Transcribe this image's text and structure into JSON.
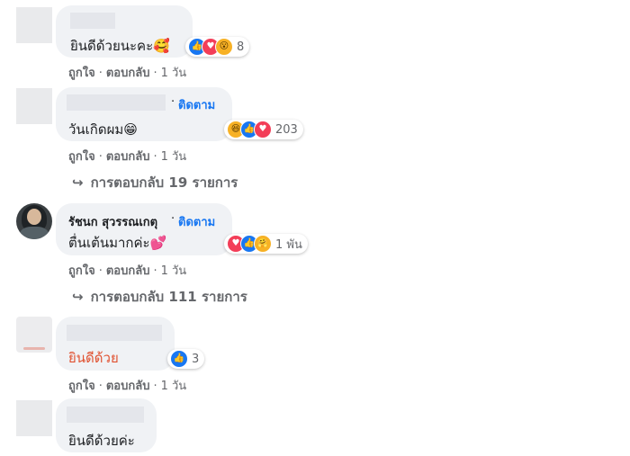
{
  "comments": [
    {
      "text": "ยินดีด้วยนะคะ🥰",
      "reaction_count": "8",
      "reaction_icons": [
        "like-icon",
        "love-icon",
        "wow-icon"
      ],
      "actions": {
        "like": "ถูกใจ",
        "reply": "ตอบกลับ",
        "time": "1 วัน"
      }
    },
    {
      "follow": "ติดตาม",
      "text": "วันเกิดผม😁",
      "reaction_count": "203",
      "reaction_icons": [
        "haha-icon",
        "like-icon",
        "love-icon"
      ],
      "actions": {
        "like": "ถูกใจ",
        "reply": "ตอบกลับ",
        "time": "1 วัน"
      },
      "replies": "การตอบกลับ 19 รายการ"
    },
    {
      "author": "รัชนก สุวรรณเกตุ",
      "follow": "ติดตาม",
      "text": "ตื่นเต้นมากค่ะ💕",
      "reaction_count": "1 พัน",
      "reaction_icons": [
        "love-icon",
        "like-icon",
        "care-icon"
      ],
      "actions": {
        "like": "ถูกใจ",
        "reply": "ตอบกลับ",
        "time": "1 วัน"
      },
      "replies": "การตอบกลับ 111 รายการ"
    },
    {
      "text": "ยินดีด้วย",
      "reaction_count": "3",
      "reaction_icons": [
        "like-icon"
      ],
      "actions": {
        "like": "ถูกใจ",
        "reply": "ตอบกลับ",
        "time": "1 วัน"
      }
    },
    {
      "text": "ยินดีด้วยค่ะ"
    }
  ],
  "colors": {
    "bubble": "#f0f2f5",
    "link": "#1877f2",
    "meta": "#65676b",
    "red_text": "#e0502f"
  }
}
